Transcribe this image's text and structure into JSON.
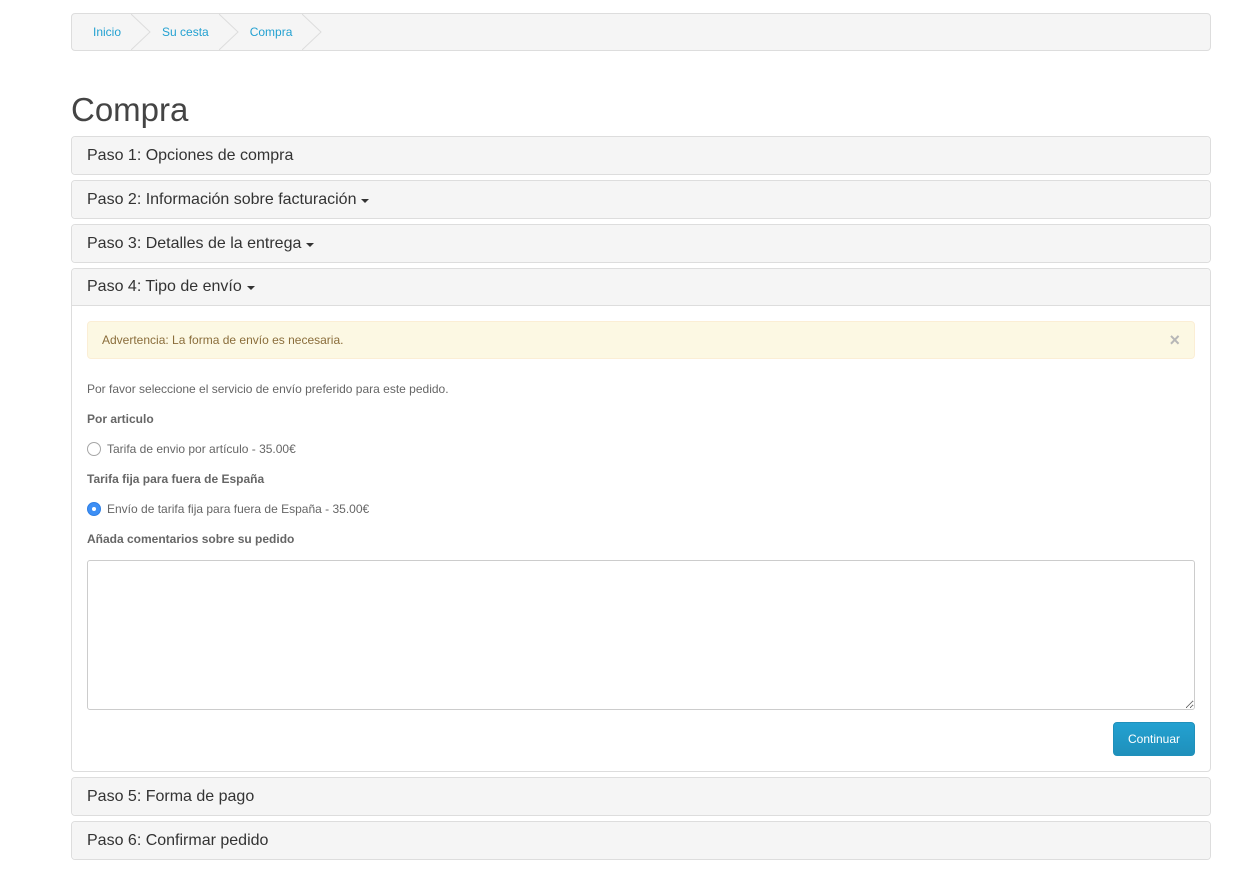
{
  "breadcrumb": [
    {
      "label": "Inicio"
    },
    {
      "label": "Su cesta"
    },
    {
      "label": "Compra"
    }
  ],
  "page_title": "Compra",
  "steps": [
    {
      "title": "Paso 1: Opciones de compra",
      "has_caret": false
    },
    {
      "title": "Paso 2: Información sobre facturación",
      "has_caret": true
    },
    {
      "title": "Paso 3: Detalles de la entrega",
      "has_caret": true
    },
    {
      "title": "Paso 4: Tipo de envío",
      "has_caret": true,
      "open": true
    },
    {
      "title": "Paso 5: Forma de pago",
      "has_caret": false
    },
    {
      "title": "Paso 6: Confirmar pedido",
      "has_caret": false
    }
  ],
  "shipping": {
    "alert_text": "Advertencia: La forma de envío es necesaria.",
    "alert_close": "×",
    "intro": "Por favor seleccione el servicio de envío preferido para este pedido.",
    "groups": [
      {
        "label": "Por articulo",
        "option": "Tarifa de envio por artículo - 35.00€",
        "checked": false
      },
      {
        "label": "Tarifa fija para fuera de España",
        "option": "Envío de tarifa fija para fuera de España - 35.00€",
        "checked": true
      }
    ],
    "comments_label": "Añada comentarios sobre su pedido",
    "comments_value": "",
    "continue_label": "Continuar"
  },
  "colors": {
    "link": "#23a1d1",
    "alert_bg": "#fcf8e3",
    "button": "#229ac8",
    "radio_checked": "#3d8ff5"
  }
}
